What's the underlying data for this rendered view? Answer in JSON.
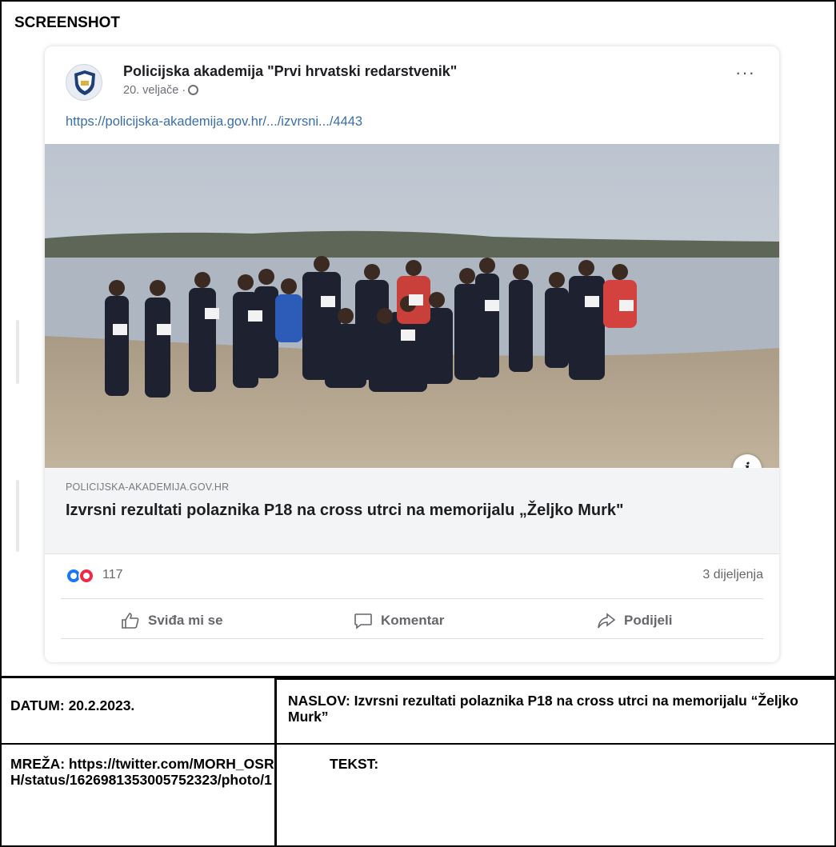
{
  "section_label": "SCREENSHOT",
  "post": {
    "page_name": "Policijska akademija \"Prvi hrvatski redarstvenik\"",
    "date": "20. veljače ·",
    "link": "https://policijska-akademija.gov.hr/.../izvrsni.../4443",
    "more_label": "···",
    "preview": {
      "domain": "POLICIJSKA-AKADEMIJA.GOV.HR",
      "title": "Izvrsni rezultati polaznika P18 na cross utrci na memorijalu „Željko Murk\""
    },
    "reaction_count": "117",
    "shares": "3 dijeljenja",
    "actions": {
      "like": "Sviđa mi se",
      "comment": "Komentar",
      "share": "Podijeli"
    },
    "info_label": "i"
  },
  "meta": {
    "datum": "DATUM: 20.2.2023.",
    "naslov": "NASLOV: Izvrsni rezultati polaznika P18 na cross utrci na memorijalu “Željko Murk”",
    "mreza": "MREŽA: https://twitter.com/MORH_OSRH/status/1626981353005752323/photo/1",
    "tekst": "TEKST:"
  }
}
